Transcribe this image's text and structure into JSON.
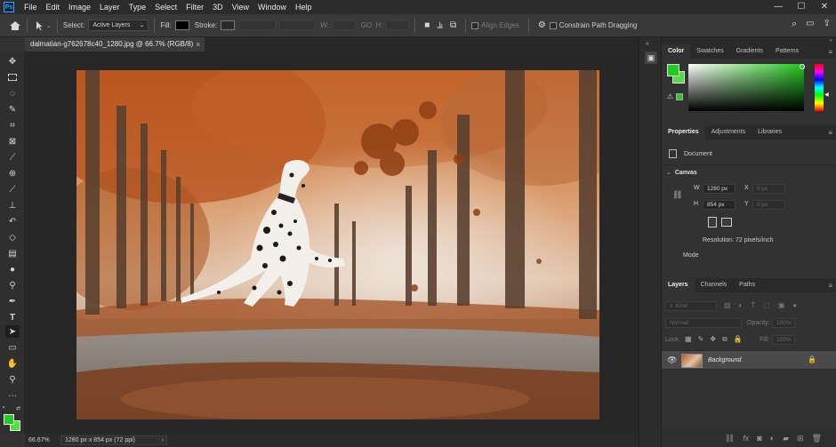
{
  "app": {
    "logo": "Ps"
  },
  "menu": [
    "File",
    "Edit",
    "Image",
    "Layer",
    "Type",
    "Select",
    "Filter",
    "3D",
    "View",
    "Window",
    "Help"
  ],
  "window_controls": {
    "minimize": "—",
    "maximize": "☐",
    "close": "✕"
  },
  "options_bar": {
    "select_label": "Select:",
    "select_value": "Active Layers",
    "fill_label": "Fill:",
    "stroke_label": "Stroke:",
    "w_label": "W:",
    "h_label": "H:",
    "link_glyph": "GO",
    "align_edges": "Align Edges",
    "constrain": "Constrain Path Dragging"
  },
  "document": {
    "tab_title": "dalmatian-g762678c40_1280.jpg @ 66.7% (RGB/8)",
    "close": "×"
  },
  "status": {
    "zoom": "66.67%",
    "info": "1280 px x 854 px (72 ppi)",
    "arrow": "›"
  },
  "color_panel": {
    "tabs": [
      "Color",
      "Swatches",
      "Gradients",
      "Patterns"
    ],
    "active_tab": "Color",
    "foreground": "#22cc22",
    "hue_color": "#23c81f"
  },
  "properties_panel": {
    "tabs": [
      "Properties",
      "Adjustments",
      "Libraries"
    ],
    "document_label": "Document",
    "canvas_heading": "Canvas",
    "w_label": "W",
    "w_value": "1280 px",
    "h_label": "H",
    "h_value": "854 px",
    "x_label": "X",
    "x_value": "0 px",
    "y_label": "Y",
    "y_value": "0 px",
    "resolution": "Resolution: 72 pixels/inch",
    "mode_label": "Mode"
  },
  "layers_panel": {
    "tabs": [
      "Layers",
      "Channels",
      "Paths"
    ],
    "kind_placeholder": "Kind",
    "blend_mode": "Normal",
    "opacity_label": "Opacity:",
    "opacity_value": "100%",
    "lock_label": "Lock:",
    "fill_label": "Fill:",
    "fill_value": "100%",
    "layers": [
      {
        "name": "Background",
        "visible": true,
        "locked": true
      }
    ],
    "footer_icons": [
      "link-icon",
      "fx-icon",
      "mask-icon",
      "adjustment-icon",
      "group-icon",
      "new-layer-icon",
      "trash-icon"
    ]
  },
  "colors": {
    "accent": "#31a8ff",
    "foreground_swatch": "#22cc22",
    "background_swatch": "#55dd44"
  }
}
